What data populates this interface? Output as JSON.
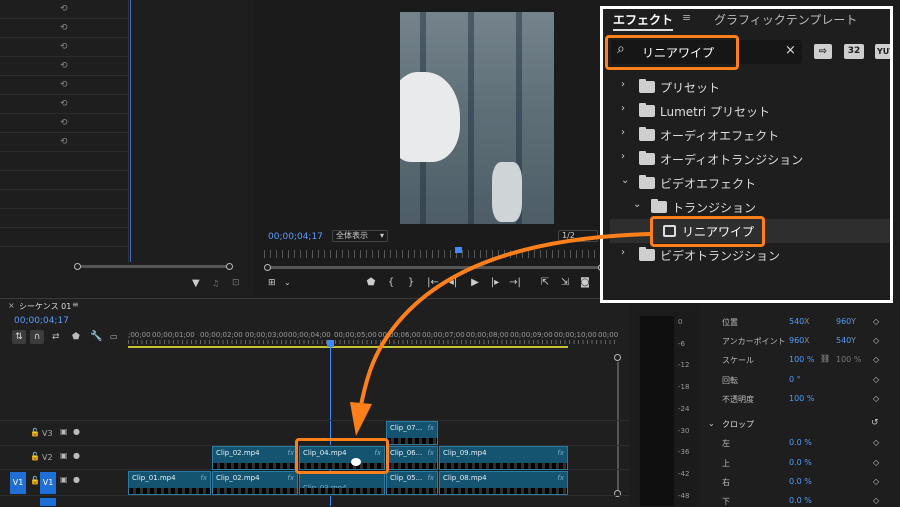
{
  "colors": {
    "accent_orange": "#ff7f1a",
    "timecode_blue": "#4f9dff",
    "clip_blue": "#145470"
  },
  "program": {
    "timecode": "00;00;04;17",
    "zoom": "全体表示",
    "quality": "1/2"
  },
  "sequence": {
    "tab": "シーケンス 01",
    "timecode": "00;00;04;17",
    "ruler": [
      ";00;00",
      "00;00;01;00",
      "00;00;02;00",
      "00;00;03;00",
      "00;00;04;00",
      "00;00;05;00",
      "00;00;06;00",
      "00;00;07;00",
      "00;00;08;00",
      "00;00;09;00",
      "00;00;10;00",
      "00;00"
    ],
    "tracks": {
      "v3": "V3",
      "v2": "V2",
      "v1": "V1",
      "v1_src": "V1"
    },
    "clips": {
      "c7": "Clip_07...",
      "c2a": "Clip_02.mp4",
      "c4": "Clip_04.mp4",
      "c6": "Clip_06...",
      "c9": "Clip_09.mp4",
      "c1": "Clip_01.mp4",
      "c2b": "Clip_02.mp4",
      "c3": "Clip_03.mp4",
      "c5": "Clip_05...",
      "c8": "Clip_08.mp4"
    },
    "fx": "fx"
  },
  "effects": {
    "tab_effects": "エフェクト",
    "tab_graphics": "グラフィックテンプレート",
    "search": "リニアワイプ",
    "badge32": "32",
    "badgeyuv": "YUV",
    "items": [
      "プリセット",
      "Lumetri プリセット",
      "オーディオエフェクト",
      "オーディオトランジション",
      "ビデオエフェクト",
      "トランジション",
      "リニアワイプ",
      "ビデオトランジション"
    ]
  },
  "controls": {
    "position": "位置",
    "position_x": "540",
    "position_y": "960",
    "anchor": "アンカーポイント",
    "anchor_x": "960",
    "anchor_y": "540",
    "scale": "スケール",
    "scale_val": "100 %",
    "scale_w": "100 %",
    "rotation": "回転",
    "rotation_val": "0 °",
    "opacity": "不透明度",
    "opacity_val": "100 %",
    "crop": "クロップ",
    "left": "左",
    "left_val": "0.0 %",
    "top": "上",
    "top_val": "0.0 %",
    "right": "右",
    "right_val": "0.0 %",
    "bottom": "下",
    "bottom_val": "0.0 %",
    "x": "X",
    "y": "Y"
  },
  "meter": [
    "0",
    "-6",
    "-12",
    "-18",
    "-24",
    "-30",
    "-36",
    "-42",
    "-48"
  ]
}
